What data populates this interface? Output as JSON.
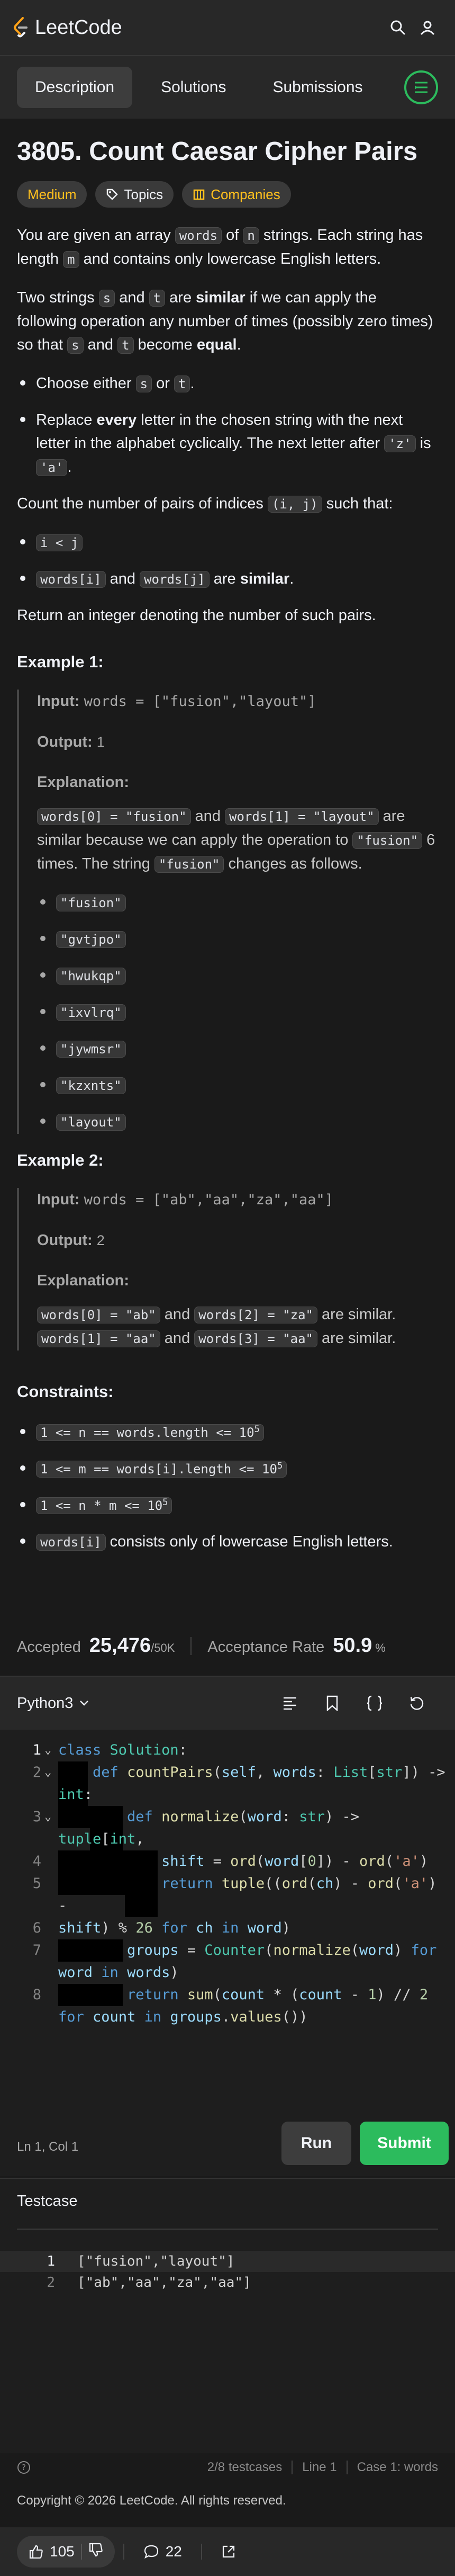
{
  "header": {
    "logo_text": "LeetCode"
  },
  "tabs": [
    {
      "label": "Description",
      "active": true
    },
    {
      "label": "Solutions",
      "active": false
    },
    {
      "label": "Submissions",
      "active": false
    }
  ],
  "problem": {
    "title": "3805. Count Caesar Cipher Pairs",
    "difficulty": "Medium",
    "topics_label": "Topics",
    "companies_label": "Companies",
    "p1": [
      "You are given an array ",
      "words",
      " of ",
      "n",
      " strings. Each string has length ",
      "m",
      " and contains only lowercase English letters."
    ],
    "p2": [
      "Two strings ",
      "s",
      " and ",
      "t",
      " are ",
      "similar",
      " if we can apply the following operation any number of times (possibly zero times) so that ",
      "s",
      " and ",
      "t",
      " become ",
      "equal",
      "."
    ],
    "op1": [
      "Choose either ",
      "s",
      " or ",
      "t",
      "."
    ],
    "op2": [
      "Replace ",
      "every",
      " letter in the chosen string with the next letter in the alphabet cyclically. The next letter after ",
      "'z'",
      " is ",
      "'a'",
      "."
    ],
    "p3": [
      "Count the number of pairs of indices ",
      "(i, j)",
      " such that:"
    ],
    "cond1": "i < j",
    "cond2": [
      "words[i]",
      " and ",
      "words[j]",
      " are ",
      "similar",
      "."
    ],
    "p4": "Return an integer denoting the number of such pairs.",
    "examples": [
      {
        "title": "Example 1:",
        "input_label": "Input:",
        "input": "words = [\"fusion\",\"layout\"]",
        "output_label": "Output:",
        "output": "1",
        "explanation_label": "Explanation:",
        "explanation": [
          "words[0] = \"fusion\"",
          " and ",
          "words[1] = \"layout\"",
          " are similar because we can apply the operation to ",
          "\"fusion\"",
          " 6 times. The string ",
          "\"fusion\"",
          " changes as follows."
        ],
        "steps": [
          "\"fusion\"",
          "\"gvtjpo\"",
          "\"hwukqp\"",
          "\"ixvlrq\"",
          "\"jywmsr\"",
          "\"kzxnts\"",
          "\"layout\""
        ]
      },
      {
        "title": "Example 2:",
        "input_label": "Input:",
        "input": "words = [\"ab\",\"aa\",\"za\",\"aa\"]",
        "output_label": "Output:",
        "output": "2",
        "explanation_label": "Explanation:",
        "explanation_lines": [
          [
            "words[0] = \"ab\"",
            " and ",
            "words[2] = \"za\"",
            " are similar."
          ],
          [
            "words[1] = \"aa\"",
            " and ",
            "words[3] = \"aa\"",
            " are similar."
          ]
        ]
      }
    ],
    "constraints_title": "Constraints:",
    "constraints": [
      {
        "text": "1 <= n == words.length <= 10",
        "sup": "5"
      },
      {
        "text": "1 <= m == words[i].length <= 10",
        "sup": "5"
      },
      {
        "text": "1 <= n * m <= 10",
        "sup": "5"
      },
      {
        "code": "words[i]",
        "text": " consists only of lowercase English letters."
      }
    ]
  },
  "stats": {
    "accepted_label": "Accepted",
    "accepted_value": "25,476",
    "accepted_total": "/50K",
    "rate_label": "Acceptance Rate",
    "rate_value": "50.9",
    "rate_unit": "%"
  },
  "editor": {
    "language": "Python3",
    "line_numbers": [
      "1",
      "2",
      "3",
      "4",
      "5",
      "6",
      "7",
      "8"
    ],
    "cursor_position": "Ln 1, Col 1",
    "run_label": "Run",
    "submit_label": "Submit"
  },
  "testcase": {
    "title": "Testcase",
    "lines": [
      "[\"fusion\",\"layout\"]",
      "[\"ab\",\"aa\",\"za\",\"aa\"]"
    ],
    "status": [
      "2/8 testcases",
      "Line 1",
      "Case 1: words"
    ]
  },
  "footer": {
    "copyright": "Copyright © 2026 LeetCode. All rights reserved."
  },
  "bottom_bar": {
    "likes": "105",
    "comments": "22"
  },
  "colors": {
    "accent_green": "#2cbb5d",
    "medium": "#ffc01e",
    "background": "#1a1a1a"
  },
  "icons": [
    "logo-icon",
    "search-icon",
    "user-icon",
    "notes-icon",
    "chevron-down-icon",
    "format-icon",
    "bookmark-icon",
    "braces-icon",
    "reset-icon",
    "help-icon",
    "thumbs-up-icon",
    "thumbs-down-icon",
    "comment-icon",
    "share-icon"
  ]
}
